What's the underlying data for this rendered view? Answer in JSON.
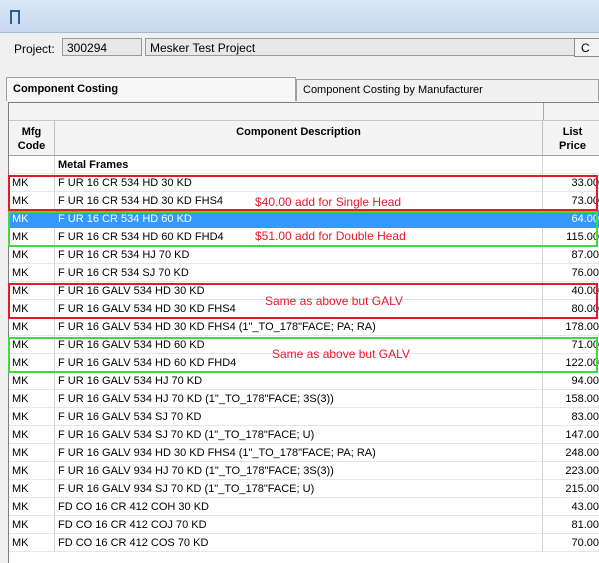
{
  "window": {
    "icon": "window-app-icon"
  },
  "project": {
    "label": "Project:",
    "number": "300294",
    "name": "Mesker Test Project",
    "button_label": "C"
  },
  "tabs": [
    {
      "label": "Component Costing",
      "active": true
    },
    {
      "label": "Component Costing by Manufacturer",
      "active": false
    }
  ],
  "columns": {
    "mfg": "Mfg\nCode",
    "description": "Component Description",
    "price": "List\nPrice"
  },
  "rows": [
    {
      "mfg": "",
      "desc": "Metal Frames",
      "price": "",
      "group": true
    },
    {
      "mfg": "MK",
      "desc": "F UR 16 CR 534 HD 30 KD",
      "price": "33.00"
    },
    {
      "mfg": "MK",
      "desc": "F UR 16 CR 534 HD 30 KD FHS4",
      "price": "73.00"
    },
    {
      "mfg": "MK",
      "desc": "F UR 16 CR 534 HD 60 KD",
      "price": "64.00",
      "selected": true
    },
    {
      "mfg": "MK",
      "desc": "F UR 16 CR 534 HD 60 KD FHD4",
      "price": "115.00"
    },
    {
      "mfg": "MK",
      "desc": "F UR 16 CR 534 HJ 70 KD",
      "price": "87.00"
    },
    {
      "mfg": "MK",
      "desc": "F UR 16 CR 534 SJ 70 KD",
      "price": "76.00"
    },
    {
      "mfg": "MK",
      "desc": "F UR 16 GALV 534 HD 30 KD",
      "price": "40.00"
    },
    {
      "mfg": "MK",
      "desc": "F UR 16 GALV 534 HD 30 KD FHS4",
      "price": "80.00"
    },
    {
      "mfg": "MK",
      "desc": "F UR 16 GALV 534 HD 30 KD FHS4 (1\"_TO_178\"FACE; PA; RA)",
      "price": "178.00"
    },
    {
      "mfg": "MK",
      "desc": "F UR 16 GALV 534 HD 60 KD",
      "price": "71.00"
    },
    {
      "mfg": "MK",
      "desc": "F UR 16 GALV 534 HD 60 KD FHD4",
      "price": "122.00"
    },
    {
      "mfg": "MK",
      "desc": "F UR 16 GALV 534 HJ 70 KD",
      "price": "94.00"
    },
    {
      "mfg": "MK",
      "desc": "F UR 16 GALV 534 HJ 70 KD (1\"_TO_178\"FACE; 3S(3))",
      "price": "158.00"
    },
    {
      "mfg": "MK",
      "desc": "F UR 16 GALV 534 SJ 70 KD",
      "price": "83.00"
    },
    {
      "mfg": "MK",
      "desc": "F UR 16 GALV 534 SJ 70 KD (1\"_TO_178\"FACE; U)",
      "price": "147.00"
    },
    {
      "mfg": "MK",
      "desc": "F UR 16 GALV 934 HD 30 KD FHS4 (1\"_TO_178\"FACE; PA; RA)",
      "price": "248.00"
    },
    {
      "mfg": "MK",
      "desc": "F UR 16 GALV 934 HJ 70 KD (1\"_TO_178\"FACE; 3S(3))",
      "price": "223.00"
    },
    {
      "mfg": "MK",
      "desc": "F UR 16 GALV 934 SJ 70 KD (1\"_TO_178\"FACE; U)",
      "price": "215.00"
    },
    {
      "mfg": "MK",
      "desc": "FD CO 16 CR 412 COH 30 KD",
      "price": "43.00"
    },
    {
      "mfg": "MK",
      "desc": "FD CO 16 CR 412 COJ 70 KD",
      "price": "81.00"
    },
    {
      "mfg": "MK",
      "desc": "FD CO 16 CR 412 COS 70 KD",
      "price": "70.00"
    }
  ],
  "annotations": [
    {
      "text": "$40.00 add for Single Head",
      "color": "#e41a2b"
    },
    {
      "text": "$51.00 add for Double Head",
      "color": "#e41a2b"
    },
    {
      "text": "Same as above but GALV",
      "color": "#e41a2b"
    },
    {
      "text": "Same as above but GALV",
      "color": "#e41a2b"
    }
  ],
  "colors": {
    "selection": "#3399ff",
    "red_box": "#e41a2b",
    "green_box": "#40d93f"
  }
}
